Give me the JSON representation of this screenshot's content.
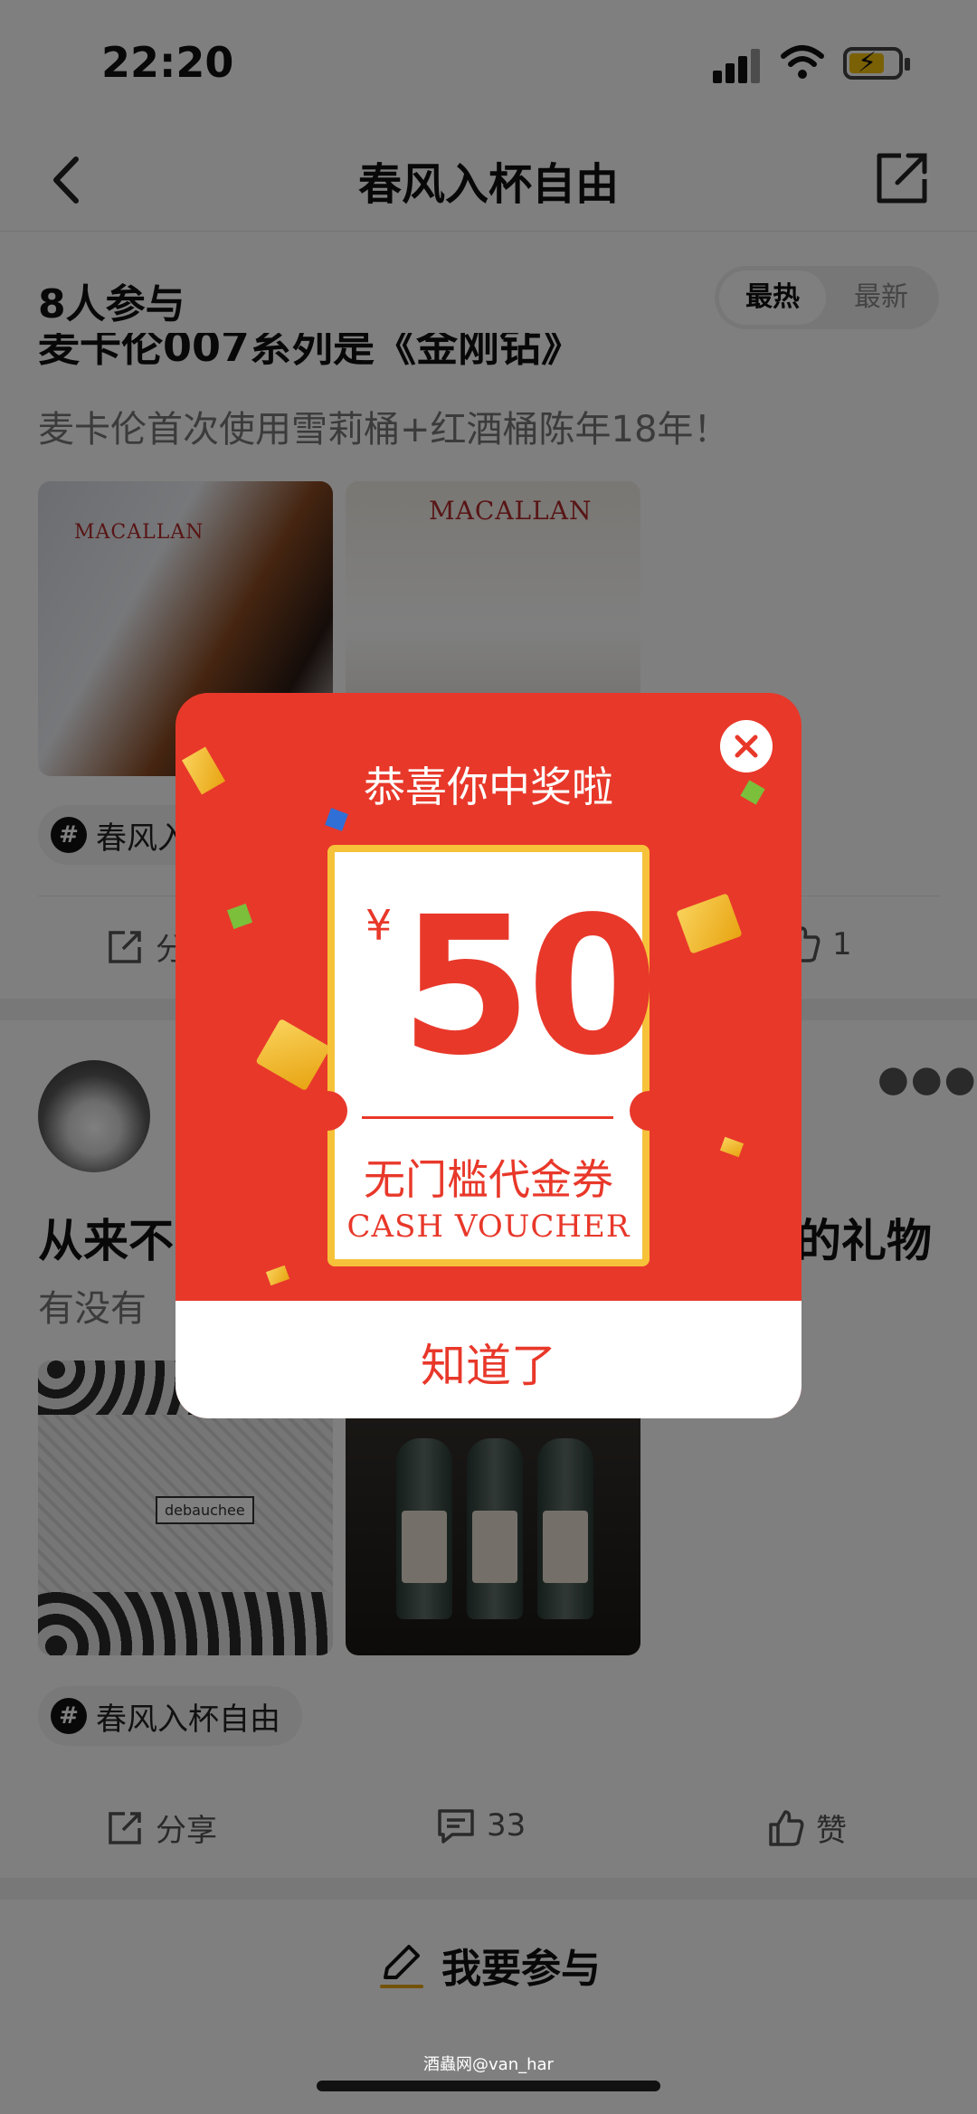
{
  "status_bar": {
    "time": "22:20"
  },
  "nav": {
    "title": "春风入杯自由"
  },
  "participants": {
    "count": "8人参与",
    "sort_hot": "最热",
    "sort_new": "最新"
  },
  "post1": {
    "title_cut": "麦卡伦007系列是《金刚钻》",
    "subtitle": "麦卡伦首次使用雪莉桶+红酒桶陈年18年！",
    "image1_brand": "MACALLAN",
    "image2_brand": "MACALLAN",
    "tag": "春风入",
    "share": "分",
    "likes": "1"
  },
  "post2": {
    "title_left": "从来不",
    "title_right": "的礼物",
    "subtitle": "有没有",
    "image_label": "debauchee",
    "tag": "春风入杯自由",
    "share": "分享",
    "comments": "33",
    "like": "赞"
  },
  "bottom": {
    "join": "我要参与",
    "watermark": "酒蟲网@van_har"
  },
  "modal": {
    "title": "恭喜你中奖啦",
    "currency": "¥",
    "amount": "50",
    "voucher_cn": "无门槛代金券",
    "voucher_en": "CASH VOUCHER",
    "button": "知道了",
    "colors": {
      "primary": "#e8382a",
      "gold": "#f6c23a"
    }
  }
}
